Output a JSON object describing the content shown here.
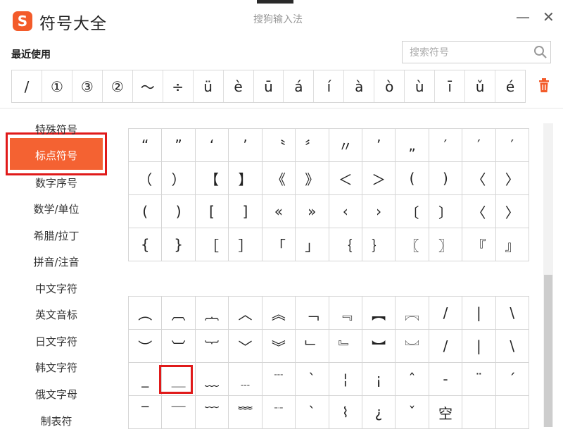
{
  "window": {
    "title": "符号大全",
    "app_name": "搜狗输入法",
    "logo_glyph": "S",
    "minimize_glyph": "—",
    "close_glyph": "✕",
    "accent_color": "#f46232",
    "highlight_color": "#e01a1a"
  },
  "recent": {
    "label": "最近使用",
    "symbols": [
      "/",
      "①",
      "③",
      "②",
      "～",
      "÷",
      "ü",
      "è",
      "ū",
      "á",
      "í",
      "à",
      "ò",
      "ù",
      "ī",
      "ǔ",
      "é"
    ],
    "trash_icon": "trash-icon"
  },
  "search": {
    "placeholder": "搜索符号",
    "value": ""
  },
  "sidebar": {
    "items": [
      {
        "label": "特殊符号"
      },
      {
        "label": "标点符号"
      },
      {
        "label": "数字序号"
      },
      {
        "label": "数学/单位"
      },
      {
        "label": "希腊/拉丁"
      },
      {
        "label": "拼音/注音"
      },
      {
        "label": "中文字符"
      },
      {
        "label": "英文音标"
      },
      {
        "label": "日文字符"
      },
      {
        "label": "韩文字符"
      },
      {
        "label": "俄文字母"
      },
      {
        "label": "制表符"
      }
    ],
    "active_index": 1
  },
  "punctuation_grid": {
    "columns": 12,
    "cells": [
      "“",
      "”",
      "‘",
      "’",
      "〝",
      "〞",
      "〃",
      "’",
      "„",
      "′",
      "′",
      "′",
      "（",
      "）",
      "【",
      "】",
      "《",
      "》",
      "＜",
      "＞",
      "(",
      ")",
      "〈",
      "〉",
      "(",
      ")",
      "[",
      "]",
      "«",
      "»",
      "‹",
      "›",
      "〔",
      "〕",
      "〈",
      "〉",
      "{",
      "}",
      "［",
      "］",
      "「",
      "」",
      "｛",
      "｝",
      "〖",
      "〗",
      "『",
      "』"
    ]
  },
  "line_grid": {
    "columns": 12,
    "cells": [
      "︵",
      "︹",
      "︷",
      "︿",
      "︽",
      "﹁",
      "﹃",
      "︻",
      "︗",
      "/",
      "|",
      "\\",
      "︶",
      "︺",
      "︸",
      "﹀",
      "︾",
      "﹂",
      "﹄",
      "︼",
      "︘",
      "/",
      "|",
      "\\",
      "_",
      "＿",
      "﹏",
      "﹍",
      "﹉",
      "ˋ",
      "¦",
      "¡",
      "ˆ",
      "-",
      "¨",
      "ˊ",
      "‾",
      "￣",
      "﹋",
      "﹌",
      "﹊",
      "ˋ",
      "⌇",
      "¿",
      "ˇ",
      "空",
      "",
      ""
    ]
  }
}
